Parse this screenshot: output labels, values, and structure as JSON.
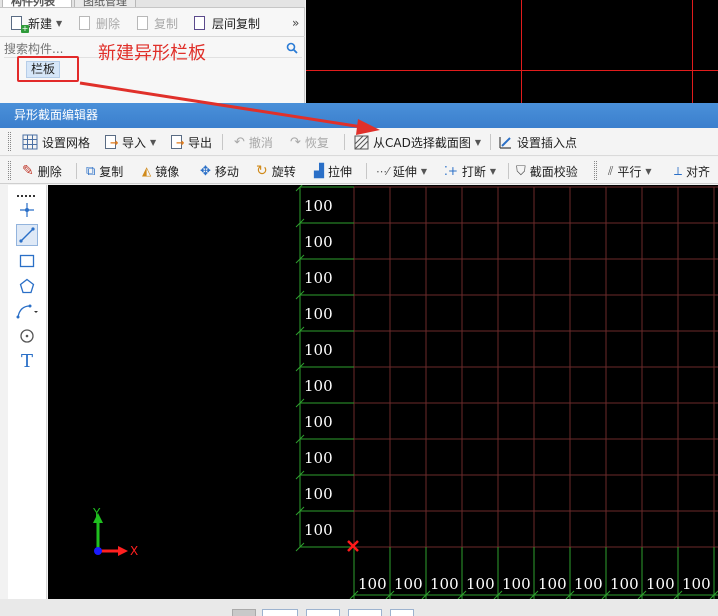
{
  "left_panel": {
    "tabs": [
      "构件列表",
      "图纸管理"
    ],
    "toolbar": {
      "new_label": "新建",
      "delete_label": "删除",
      "copy_label": "复制",
      "floor_copy_label": "层间复制",
      "more_glyph": "»"
    },
    "search_placeholder": "搜索构件...",
    "tree_item": "栏板"
  },
  "annotation_text": "新建异形栏板",
  "editor": {
    "title": "异形截面编辑器",
    "toolbar1": {
      "grid": "设置网格",
      "import": "导入",
      "export": "导出",
      "undo": "撤消",
      "redo": "恢复",
      "select_cad": "从CAD选择截面图",
      "insert_point": "设置插入点"
    },
    "toolbar2": {
      "delete": "删除",
      "copy": "复制",
      "mirror": "镜像",
      "move": "移动",
      "rotate": "旋转",
      "stretch": "拉伸",
      "extend": "延伸",
      "break": "打断",
      "check": "截面校验",
      "parallel": "平行",
      "align": "对齐"
    },
    "left_tools": [
      "dotted-line-icon",
      "point-icon",
      "line-icon",
      "rectangle-icon",
      "polygon-icon",
      "arc-icon",
      "circle-icon",
      "text-icon"
    ]
  },
  "canvas": {
    "row_labels": [
      "100",
      "100",
      "100",
      "100",
      "100",
      "100",
      "100",
      "100",
      "100",
      "100"
    ],
    "col_labels": [
      "100",
      "100",
      "100",
      "100",
      "100",
      "100",
      "100",
      "100",
      "100",
      "100"
    ],
    "axis_x_label": "X",
    "axis_y_label": "Y",
    "colors": {
      "grid": "#6b2a2a",
      "dim": "#2ea02e",
      "origin_mark": "#ff1a1a"
    }
  },
  "colors": {
    "title_bar": "#3b7fcd",
    "annotation": "#e0302a",
    "cad_line": "#e11c1c"
  }
}
